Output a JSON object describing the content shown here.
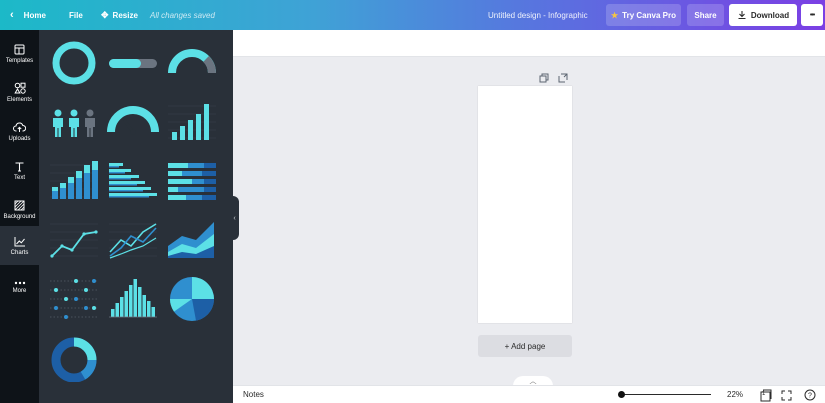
{
  "topbar": {
    "home_label": "Home",
    "file_label": "File",
    "resize_label": "Resize",
    "save_status": "All changes saved",
    "design_title": "Untitled design - Infographic",
    "try_pro_label": "Try Canva Pro",
    "share_label": "Share",
    "download_label": "Download",
    "more_label": "•••",
    "pro_star": "★",
    "accent_start": "#1cb9c8",
    "accent_end": "#7b3fe4"
  },
  "sidebar": {
    "items": [
      {
        "label": "Templates",
        "icon": "templates-icon"
      },
      {
        "label": "Elements",
        "icon": "elements-icon"
      },
      {
        "label": "Uploads",
        "icon": "uploads-icon"
      },
      {
        "label": "Text",
        "icon": "text-icon"
      },
      {
        "label": "Background",
        "icon": "background-icon"
      },
      {
        "label": "Charts",
        "icon": "charts-icon"
      },
      {
        "label": "More",
        "icon": "more-icon"
      }
    ],
    "active": "Charts"
  },
  "panel": {
    "colors": {
      "primary": "#5ce0e6",
      "secondary": "#2f8fcf",
      "dark": "#1d5fa6",
      "muted": "#6b7480"
    },
    "charts": [
      "donut-ring",
      "progress-bar",
      "half-gauge",
      "people-icons",
      "speedometer",
      "bar-ascending",
      "bar-stacked",
      "bar-horizontal",
      "bar-horizontal-stacked",
      "line-single",
      "line-multi",
      "area-stacked",
      "dot-matrix",
      "histogram",
      "pie",
      "donut-multi"
    ]
  },
  "editor": {
    "add_page_label": "+ Add page"
  },
  "bottombar": {
    "notes_label": "Notes",
    "zoom_value": "22%",
    "zoom_fraction": 0.22,
    "page_count": "1"
  }
}
